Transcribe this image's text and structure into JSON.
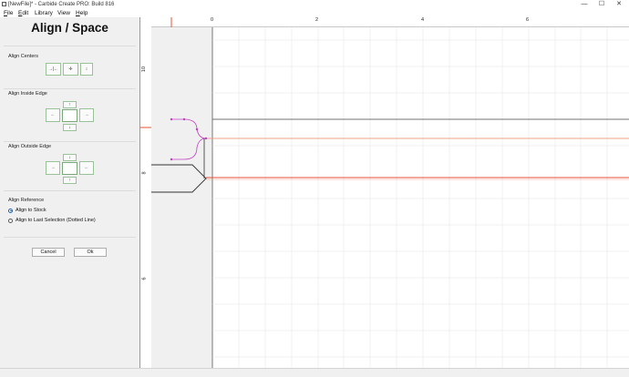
{
  "window": {
    "title": "[NewFile]* - Carbide Create PRO: Build 816",
    "minimize_glyph": "—",
    "maximize_glyph": "☐",
    "close_glyph": "✕"
  },
  "menu": {
    "items": [
      {
        "label": "File",
        "accel": "F",
        "rest": "ile"
      },
      {
        "label": "Edit",
        "accel": "E",
        "rest": "dit"
      },
      {
        "label": "Library",
        "accel": "",
        "rest": "Library"
      },
      {
        "label": "View",
        "accel": "",
        "rest": "View"
      },
      {
        "label": "Help",
        "accel": "H",
        "rest": "elp"
      }
    ]
  },
  "panel": {
    "title": "Align / Space",
    "align_centers_label": "Align Centers",
    "align_inside_label": "Align Inside Edge",
    "align_outside_label": "Align Outside Edge",
    "align_reference_label": "Align Reference",
    "radio_stock": "Align to Stock",
    "radio_last_selection": "Align to Last Selection (Dotted Line)",
    "selected_reference": "stock",
    "cancel_label": "Cancel",
    "ok_label": "Ok"
  },
  "rulers": {
    "top_ticks": [
      "0",
      "2",
      "4",
      "6"
    ],
    "left_ticks": [
      "10",
      "8",
      "6"
    ]
  },
  "colors": {
    "accent_red": "#e8503a",
    "guide_orange": "#f0a28a",
    "magenta": "#c040c0",
    "grid": "#e6e6e6"
  }
}
